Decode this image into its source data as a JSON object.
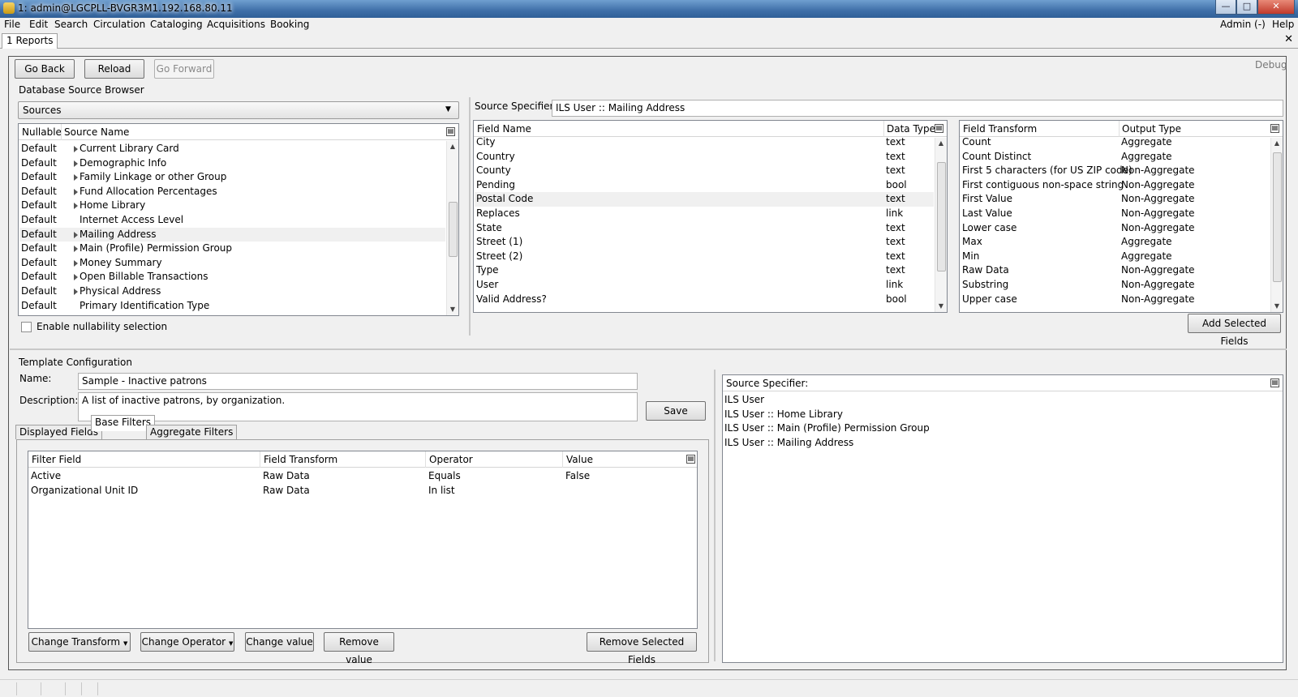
{
  "window": {
    "title": "1: admin@LGCPLL-BVGR3M1.192.168.80.11"
  },
  "menubar": {
    "items": [
      "File",
      "Edit",
      "Search",
      "Circulation",
      "Cataloging",
      "Acquisitions",
      "Booking"
    ],
    "admin": "Admin (-)",
    "help": "Help"
  },
  "tabs": {
    "active": "1 Reports"
  },
  "toolbar": {
    "back": "Go Back",
    "reload": "Reload",
    "forward": "Go Forward",
    "debug": "Debug"
  },
  "db_browser": {
    "title": "Database Source Browser",
    "sources_label": "Sources",
    "cols": {
      "nullable": "Nullable",
      "source": "Source Name"
    },
    "rows": [
      {
        "nullable": "Default",
        "name": "Current Library Card",
        "expandable": true
      },
      {
        "nullable": "Default",
        "name": "Demographic Info",
        "expandable": true
      },
      {
        "nullable": "Default",
        "name": "Family Linkage or other Group",
        "expandable": true
      },
      {
        "nullable": "Default",
        "name": "Fund Allocation Percentages",
        "expandable": true
      },
      {
        "nullable": "Default",
        "name": "Home Library",
        "expandable": true
      },
      {
        "nullable": "Default",
        "name": "Internet Access Level",
        "expandable": false
      },
      {
        "nullable": "Default",
        "name": "Mailing Address",
        "expandable": true
      },
      {
        "nullable": "Default",
        "name": "Main (Profile) Permission Group",
        "expandable": true
      },
      {
        "nullable": "Default",
        "name": "Money Summary",
        "expandable": true
      },
      {
        "nullable": "Default",
        "name": "Open Billable Transactions",
        "expandable": true
      },
      {
        "nullable": "Default",
        "name": "Physical Address",
        "expandable": true
      },
      {
        "nullable": "Default",
        "name": "Primary Identification Type",
        "expandable": false
      }
    ],
    "nullability_label": "Enable nullability selection"
  },
  "source_spec": {
    "label": "Source Specifier:",
    "value": "ILS User :: Mailing Address"
  },
  "fields": {
    "cols": {
      "name": "Field Name",
      "type": "Data Type"
    },
    "rows": [
      {
        "name": "City",
        "type": "text"
      },
      {
        "name": "Country",
        "type": "text"
      },
      {
        "name": "County",
        "type": "text"
      },
      {
        "name": "Pending",
        "type": "bool"
      },
      {
        "name": "Postal Code",
        "type": "text"
      },
      {
        "name": "Replaces",
        "type": "link"
      },
      {
        "name": "State",
        "type": "text"
      },
      {
        "name": "Street (1)",
        "type": "text"
      },
      {
        "name": "Street (2)",
        "type": "text"
      },
      {
        "name": "Type",
        "type": "text"
      },
      {
        "name": "User",
        "type": "link"
      },
      {
        "name": "Valid Address?",
        "type": "bool"
      }
    ]
  },
  "transforms": {
    "cols": {
      "transform": "Field Transform",
      "output": "Output Type"
    },
    "rows": [
      {
        "t": "Count",
        "o": "Aggregate"
      },
      {
        "t": "Count Distinct",
        "o": "Aggregate"
      },
      {
        "t": "First 5 characters (for US ZIP code)",
        "o": "Non-Aggregate"
      },
      {
        "t": "First contiguous non-space string",
        "o": "Non-Aggregate"
      },
      {
        "t": "First Value",
        "o": "Non-Aggregate"
      },
      {
        "t": "Last Value",
        "o": "Non-Aggregate"
      },
      {
        "t": "Lower case",
        "o": "Non-Aggregate"
      },
      {
        "t": "Max",
        "o": "Aggregate"
      },
      {
        "t": "Min",
        "o": "Aggregate"
      },
      {
        "t": "Raw Data",
        "o": "Non-Aggregate"
      },
      {
        "t": "Substring",
        "o": "Non-Aggregate"
      },
      {
        "t": "Upper case",
        "o": "Non-Aggregate"
      }
    ],
    "add_button": "Add Selected Fields"
  },
  "template": {
    "title": "Template Configuration",
    "name_label": "Name:",
    "name_value": "Sample - Inactive patrons",
    "desc_label": "Description:",
    "desc_value": "A list of inactive patrons, by organization.",
    "save": "Save",
    "tabs": [
      "Displayed Fields",
      "Base Filters",
      "Aggregate Filters"
    ]
  },
  "filters": {
    "cols": {
      "field": "Filter Field",
      "transform": "Field Transform",
      "operator": "Operator",
      "value": "Value"
    },
    "rows": [
      {
        "field": "Active",
        "transform": "Raw Data",
        "operator": "Equals",
        "value": "False"
      },
      {
        "field": "Organizational Unit ID",
        "transform": "Raw Data",
        "operator": "In list",
        "value": ""
      }
    ],
    "buttons": {
      "change_transform": "Change Transform",
      "change_operator": "Change Operator",
      "change_value": "Change value",
      "remove_value": "Remove value",
      "remove_selected": "Remove Selected Fields"
    }
  },
  "specifier_list": {
    "header": "Source Specifier:",
    "items": [
      "ILS User",
      "ILS User :: Home Library",
      "ILS User :: Main (Profile) Permission Group",
      "ILS User :: Mailing Address"
    ]
  }
}
